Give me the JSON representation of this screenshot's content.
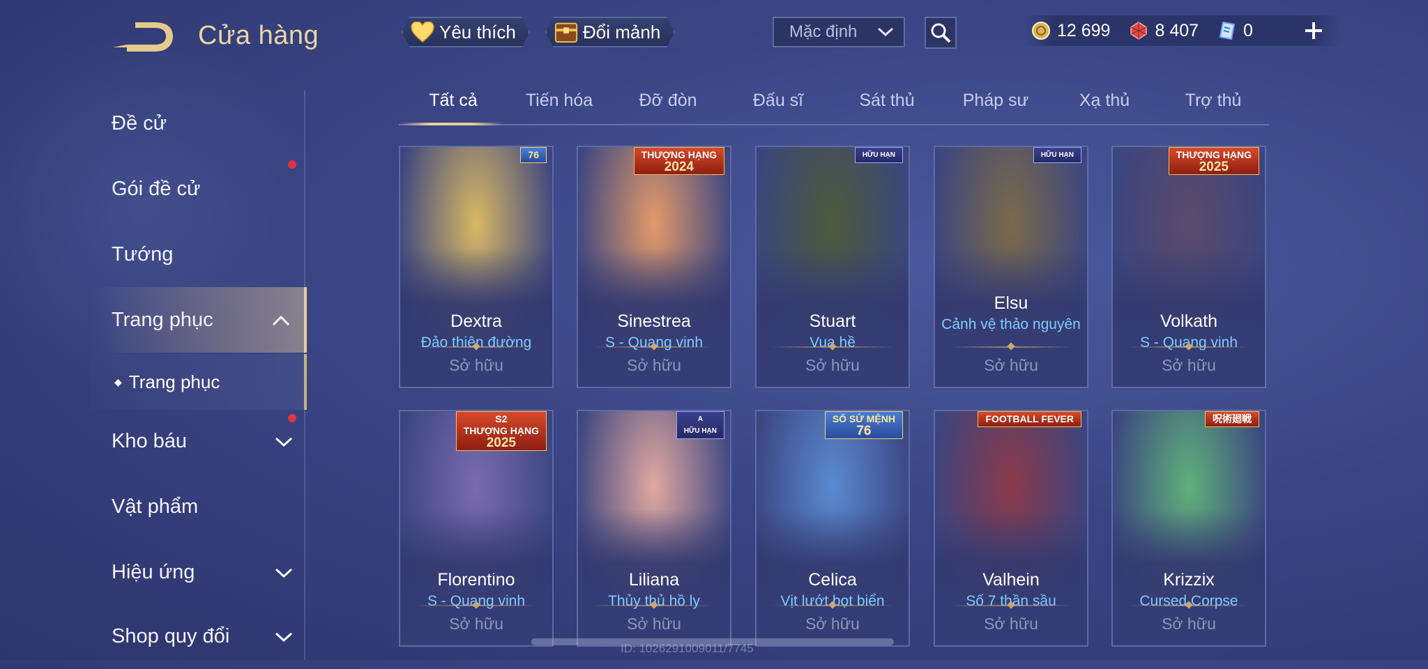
{
  "header": {
    "title": "Cửa hàng",
    "favorite_label": "Yêu thích",
    "exchange_label": "Đổi mảnh",
    "sort_value": "Mặc định"
  },
  "currency": {
    "gold": "12 699",
    "gems": "8 407",
    "vouchers": "0"
  },
  "sidebar": {
    "items": [
      {
        "label": "Đề cử"
      },
      {
        "label": "Gói đề cử"
      },
      {
        "label": "Tướng"
      },
      {
        "label": "Trang phục"
      },
      {
        "label": "Trang phục"
      },
      {
        "label": "Kho báu"
      },
      {
        "label": "Vật phẩm"
      },
      {
        "label": "Hiệu ứng"
      },
      {
        "label": "Shop quy đổi"
      }
    ]
  },
  "tabs": [
    "Tất cả",
    "Tiến hóa",
    "Đỡ đòn",
    "Đấu sĩ",
    "Sát thủ",
    "Pháp sư",
    "Xạ thủ",
    "Trợ thủ"
  ],
  "cards": [
    {
      "hero": "Dextra",
      "skin": "Đảo thiên đường",
      "status": "Sở hữu",
      "badge": "76",
      "art": "#d8b864"
    },
    {
      "hero": "Sinestrea",
      "skin": "S - Quang vinh",
      "status": "Sở hữu",
      "badge": "THƯỢNG HẠNG",
      "badge_year": "2024",
      "art": "#e29a6a"
    },
    {
      "hero": "Stuart",
      "skin": "Vua hề",
      "status": "Sở hữu",
      "badge": "HỮU HẠN",
      "art": "#4d5a3a"
    },
    {
      "hero": "Elsu",
      "skin": "Cảnh vệ thảo nguyên",
      "status": "Sở hữu",
      "badge": "HỮU HẠN",
      "art": "#7a6a4a"
    },
    {
      "hero": "Volkath",
      "skin": "S - Quang vinh",
      "status": "Sở hữu",
      "badge": "THƯỢNG HẠNG",
      "badge_year": "2025",
      "art": "#5a4a6a"
    },
    {
      "hero": "Florentino",
      "skin": "S - Quang vinh",
      "status": "Sở hữu",
      "badge": "S2",
      "badge_sub": "THƯỢNG HẠNG",
      "badge_year": "2025",
      "art": "#7a6ab0"
    },
    {
      "hero": "Liliana",
      "skin": "Thủy thủ hồ ly",
      "status": "Sở hữu",
      "badge": "A",
      "badge_sub": "HỮU HẠN",
      "art": "#e0a8a0"
    },
    {
      "hero": "Celica",
      "skin": "Vịt lướt bọt biển",
      "status": "Sở hữu",
      "badge": "SỔ SỨ MỆNH",
      "badge_year": "76",
      "art": "#5a8ad0"
    },
    {
      "hero": "Valhein",
      "skin": "Số 7 thần sầu",
      "status": "Sở hữu",
      "badge": "FOOTBALL FEVER",
      "art": "#8a3a4a"
    },
    {
      "hero": "Krizzix",
      "skin": "Cursed Corpse",
      "status": "Sở hữu",
      "badge": "呪術廻戦",
      "art": "#5fb07a"
    }
  ],
  "footer_id": "ID: 1026291009011/7745",
  "colors": {
    "accent": "#e6cf9b",
    "sub_text": "#7ecbff",
    "notify": "#e0334a"
  }
}
